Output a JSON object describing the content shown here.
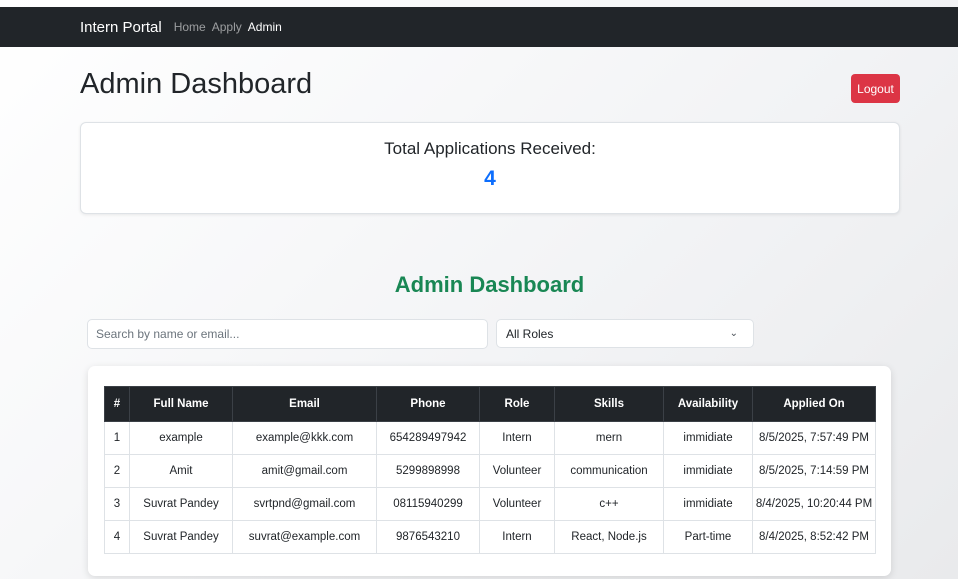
{
  "nav": {
    "brand": "Intern Portal",
    "links": [
      "Home",
      "Apply",
      "Admin"
    ]
  },
  "header": {
    "title": "Admin Dashboard",
    "logout_label": "Logout"
  },
  "stats": {
    "label": "Total Applications Received:",
    "value": "4"
  },
  "section": {
    "title": "Admin Dashboard"
  },
  "filters": {
    "search_placeholder": "Search by name or email...",
    "role_selected": "All Roles"
  },
  "table": {
    "columns": [
      "#",
      "Full Name",
      "Email",
      "Phone",
      "Role",
      "Skills",
      "Availability",
      "Applied On"
    ],
    "rows": [
      [
        "1",
        "example",
        "example@kkk.com",
        "654289497942",
        "Intern",
        "mern",
        "immidiate",
        "8/5/2025, 7:57:49 PM"
      ],
      [
        "2",
        "Amit",
        "amit@gmail.com",
        "5299898998",
        "Volunteer",
        "communication",
        "immidiate",
        "8/5/2025, 7:14:59 PM"
      ],
      [
        "3",
        "Suvrat Pandey",
        "svrtpnd@gmail.com",
        "08115940299",
        "Volunteer",
        "c++",
        "immidiate",
        "8/4/2025, 10:20:44 PM"
      ],
      [
        "4",
        "Suvrat Pandey",
        "suvrat@example.com",
        "9876543210",
        "Intern",
        "React, Node.js",
        "Part-time",
        "8/4/2025, 8:52:42 PM"
      ]
    ]
  },
  "colors": {
    "navbar": "#212529",
    "logout": "#dc3545",
    "stat_value": "#0d6efd",
    "section_title": "#198754"
  },
  "icons": {
    "select_caret": "chevron-down-icon"
  }
}
